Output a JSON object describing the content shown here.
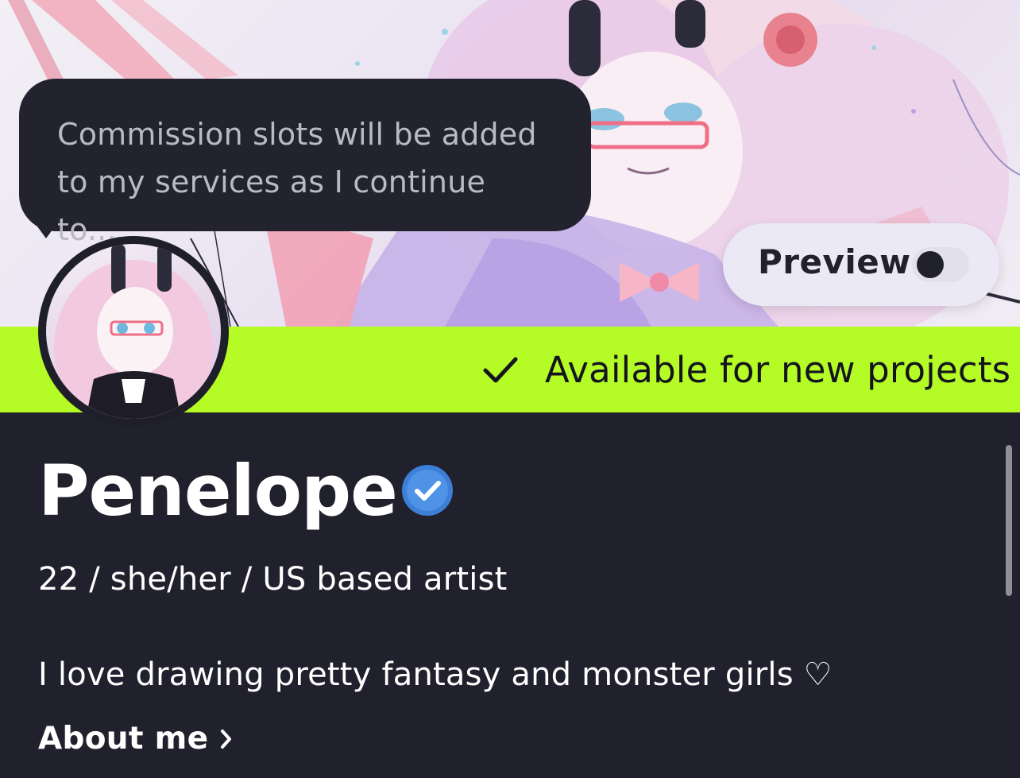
{
  "banner": {
    "bubble_text": "Commission slots will be added to my services as I continue to...",
    "preview": {
      "label": "Preview",
      "toggle_on": false
    }
  },
  "status": {
    "label": "Available for new projects",
    "color": "#b5fb26"
  },
  "profile": {
    "name": "Penelope",
    "verified": true,
    "meta": "22 / she/her / US based artist",
    "bio": "I love drawing pretty fantasy and monster girls ♡",
    "about_label": "About me"
  },
  "colors": {
    "background": "#20212d",
    "bubble": "#22232f",
    "verified_badge": "#3d7fd6",
    "preview_pill": "#ece9f6"
  },
  "icons": {
    "status": "checkmark-icon",
    "verified": "verified-badge-icon",
    "about": "chevron-right-icon",
    "toggle": "toggle-switch"
  }
}
